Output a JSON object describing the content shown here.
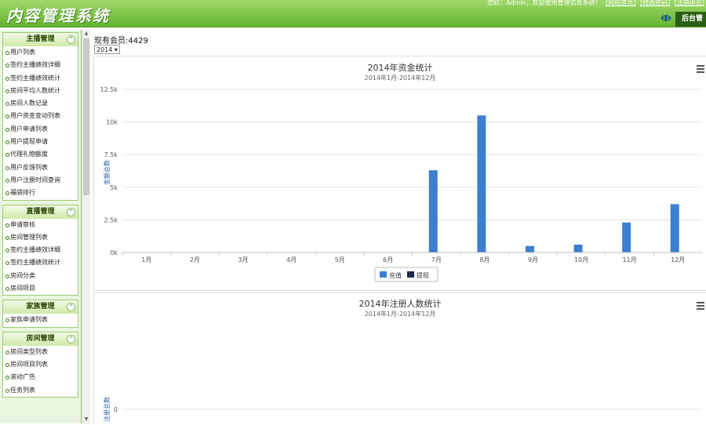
{
  "header": {
    "app_title": "内容管理系统",
    "welcome_text": "您好：Admin，欢迎使用管理信息系统！",
    "links": [
      "[网站首页]",
      "[修改密码]",
      "[注销退出]"
    ],
    "admin_tab": "后台管",
    "accent": "#63b42f"
  },
  "sidebar": {
    "groups": [
      {
        "title": "主播管理",
        "items": [
          "用户列表",
          "签约主播绩效详细",
          "签约主播绩效统计",
          "房间平均人数统计",
          "房间人数记录",
          "用户资金变动列表",
          "用户申请列表",
          "用户提现申请",
          "代理礼物额度",
          "用户反馈列表",
          "用户注册时间查询",
          "福袋排行"
        ]
      },
      {
        "title": "直播管理",
        "items": [
          "申请审核",
          "房间管理列表",
          "签约主播绩效详细",
          "签约主播绩效统计",
          "房间分类",
          "房间项目"
        ]
      },
      {
        "title": "家族管理",
        "items": [
          "家族申请列表"
        ]
      },
      {
        "title": "房间管理",
        "items": [
          "房间类型列表",
          "房间项目列表",
          "滚动广告",
          "任务列表"
        ]
      }
    ]
  },
  "main": {
    "members_label": "现有会员:4429",
    "year_select": "2014"
  },
  "chart1": {
    "title": "2014年资金统计",
    "subtitle": "2014年1月-2014年12月",
    "ylabel": "金额总数",
    "y_ticks": [
      "0k",
      "2.5k",
      "5k",
      "7.5k",
      "10k",
      "12.5k"
    ],
    "legend": [
      {
        "name": "充值",
        "color": "#3b7fd1"
      },
      {
        "name": "提现",
        "color": "#1a2c4a"
      }
    ]
  },
  "chart2": {
    "title": "2014年注册人数统计",
    "subtitle": "2014年1月-2014年12月",
    "ylabel": "注册总数",
    "y_tick": "0"
  },
  "chart_data": [
    {
      "type": "bar",
      "title": "2014年资金统计",
      "subtitle": "2014年1月-2014年12月",
      "xlabel": "",
      "ylabel": "金额总数",
      "categories": [
        "1月",
        "2月",
        "3月",
        "4月",
        "5月",
        "6月",
        "7月",
        "8月",
        "9月",
        "10月",
        "11月",
        "12月"
      ],
      "series": [
        {
          "name": "充值",
          "values": [
            0,
            0,
            0,
            0,
            0,
            0,
            6300,
            10500,
            500,
            600,
            2300,
            3700
          ]
        },
        {
          "name": "提现",
          "values": [
            0,
            0,
            0,
            0,
            0,
            0,
            0,
            0,
            0,
            0,
            0,
            0
          ]
        }
      ],
      "ylim": [
        0,
        12500
      ],
      "grid": true,
      "legend": "bottom-center"
    },
    {
      "type": "bar",
      "title": "2014年注册人数统计",
      "subtitle": "2014年1月-2014年12月",
      "ylabel": "注册总数",
      "categories": [],
      "series": [],
      "grid": true
    }
  ]
}
